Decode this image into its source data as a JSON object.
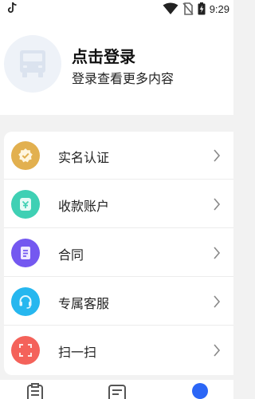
{
  "status_bar": {
    "time": "9:29",
    "icons": [
      "tiktok-icon",
      "wifi-icon",
      "no-sim-icon",
      "battery-charging-icon"
    ]
  },
  "profile": {
    "avatar_icon": "truck-icon",
    "title": "点击登录",
    "subtitle": "登录查看更多内容"
  },
  "menu": {
    "items": [
      {
        "key": "verify",
        "label": "实名认证",
        "icon": "verified-badge-icon",
        "color": "#e2b04f"
      },
      {
        "key": "account",
        "label": "收款账户",
        "icon": "wallet-icon",
        "color": "#3fd0b4"
      },
      {
        "key": "contract",
        "label": "合同",
        "icon": "contract-icon",
        "color": "#7458f0"
      },
      {
        "key": "service",
        "label": "专属客服",
        "icon": "headset-icon",
        "color": "#26b7ef"
      },
      {
        "key": "scan",
        "label": "扫一扫",
        "icon": "scan-icon",
        "color": "#f4625a"
      }
    ]
  },
  "bottom_nav": {
    "tabs": [
      "orders-icon",
      "list-icon",
      "profile-icon"
    ],
    "active_color": "#2b66f6",
    "inactive_color": "#555555"
  }
}
